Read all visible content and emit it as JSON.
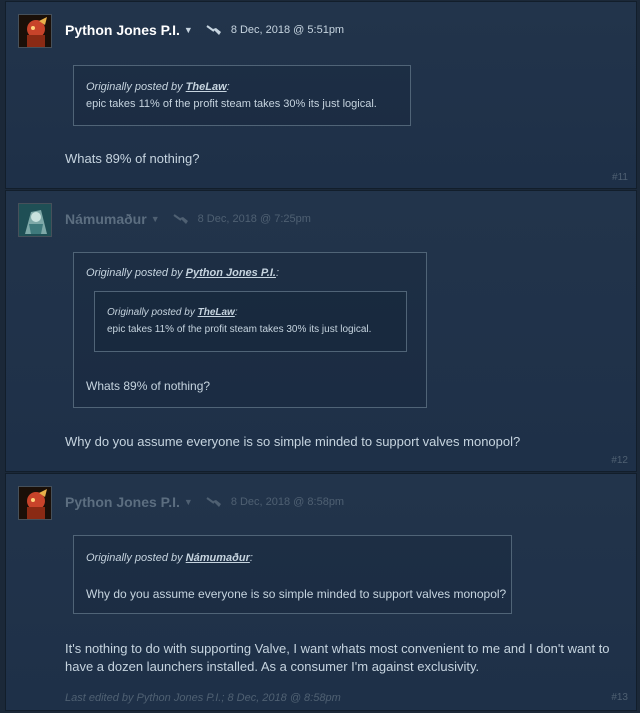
{
  "posts": [
    {
      "author": "Python Jones P.I.",
      "date": "8 Dec, 2018 @ 5:51pm",
      "quote": {
        "prefix": "Originally posted by",
        "author": "TheLaw",
        "text": "epic takes 11% of the profit steam takes 30% its just logical."
      },
      "body": "Whats 89% of nothing?",
      "number": "#11"
    },
    {
      "author": "Námumaður",
      "date": "8 Dec, 2018 @ 7:25pm",
      "quote": {
        "prefix": "Originally posted by",
        "author": "Python Jones P.I.",
        "inner": {
          "prefix": "Originally posted by",
          "author": "TheLaw",
          "text": "epic takes 11% of the profit steam takes 30% its just logical."
        },
        "text": "Whats 89% of nothing?"
      },
      "body": "Why do you assume everyone is so simple minded to support valves monopol?",
      "number": "#12"
    },
    {
      "author": "Python Jones P.I.",
      "date": "8 Dec, 2018 @ 8:58pm",
      "quote": {
        "prefix": "Originally posted by",
        "author": "Námumaður",
        "text": "Why do you assume everyone is so simple minded to support valves monopol?"
      },
      "body_line1": "It's nothing to do with supporting Valve, I want whats most convenient to me and I don't want to",
      "body_line2": "have a dozen launchers installed. As a consumer I'm against exclusivity.",
      "edited": "Last edited by Python Jones P.I.; 8 Dec, 2018 @ 8:58pm",
      "number": "#13"
    }
  ],
  "icons": {
    "avatar": "avatar-image",
    "badge": "broom-badge-icon",
    "caret": "chevron-down-icon"
  },
  "colors": {
    "background": "#1b2838",
    "text": "#c6d4df",
    "dim": "#4f6072"
  }
}
